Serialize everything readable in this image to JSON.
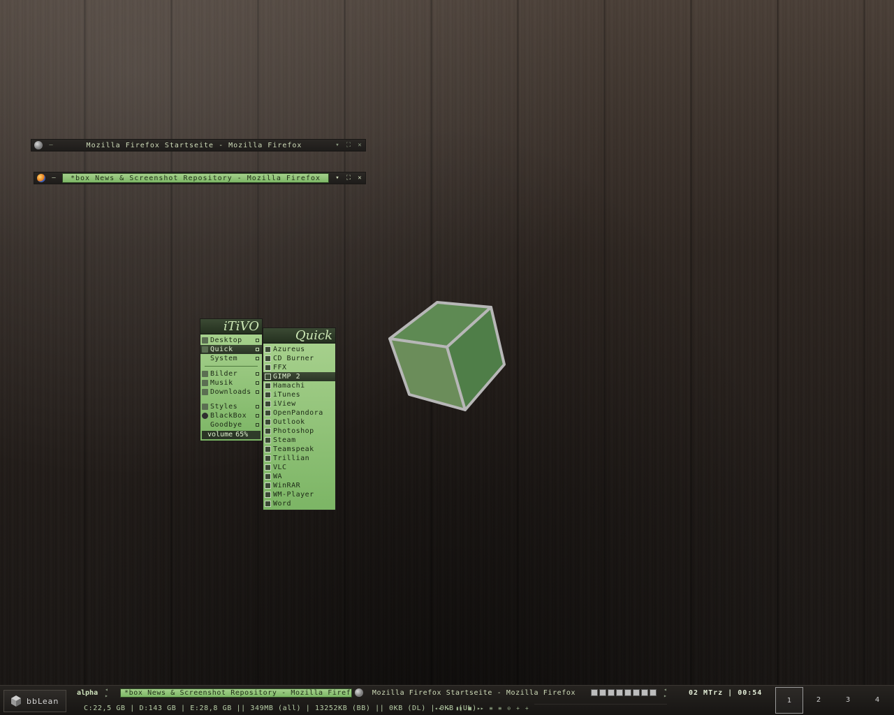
{
  "windows": {
    "startseite": {
      "title": "Mozilla Firefox Startseite - Mozilla Firefox"
    },
    "boxnews": {
      "title": "*box News & Screenshot Repository - Mozilla Firefox"
    }
  },
  "menu_main": {
    "title": "iTiVO",
    "items": [
      {
        "label": "Desktop",
        "icon": "folder-icon"
      },
      {
        "label": "Quick",
        "icon": "folder-icon",
        "active": true
      },
      {
        "label": "System",
        "icon": ""
      },
      {
        "label": "Bilder",
        "icon": "folder-icon"
      },
      {
        "label": "Musik",
        "icon": "music-icon"
      },
      {
        "label": "Downloads",
        "icon": "folder-icon"
      },
      {
        "label": "Styles",
        "icon": "folder-icon"
      },
      {
        "label": "BlackBox",
        "icon": "blackbox-icon"
      },
      {
        "label": "Goodbye",
        "icon": ""
      }
    ],
    "volume_label": "volume",
    "volume_value": "65%",
    "volume_level": 0.65
  },
  "menu_quick": {
    "title": "Quick",
    "items": [
      "Azureus",
      "CD Burner",
      "FFX",
      "GIMP 2",
      "Hamachi",
      "iTunes",
      "iView",
      "OpenPandora",
      "Outlook",
      "Photoshop",
      "Steam",
      "Teamspeak",
      "Trillian",
      "VLC",
      "WA",
      "WinRAR",
      "WM-Player",
      "Word"
    ],
    "active_index": 3
  },
  "taskbar": {
    "logo_text": "bbLean",
    "workspace_name": "alpha",
    "active_task": "*box News & Screenshot Repository - Mozilla Firefox",
    "inactive_task": "Mozilla Firefox Startseite - Mozilla Firefox",
    "clock": "02 MTrz | 00:54",
    "stats": "C:22,5 GB | D:143 GB | E:28,8 GB || 349MB (all) | 13252KB (BB) || 0KB (DL) | 0KB (UL)",
    "player_controls": [
      "◂◂",
      "▸",
      "▮▮",
      "■",
      "▸▸",
      "≡",
      "≡",
      "⊙",
      "+",
      "+"
    ],
    "workspaces": [
      "1",
      "2",
      "3",
      "4"
    ],
    "current_workspace": 0
  },
  "colors": {
    "accent_green": "#8cc373",
    "dark_bar": "#1e1c1a"
  }
}
